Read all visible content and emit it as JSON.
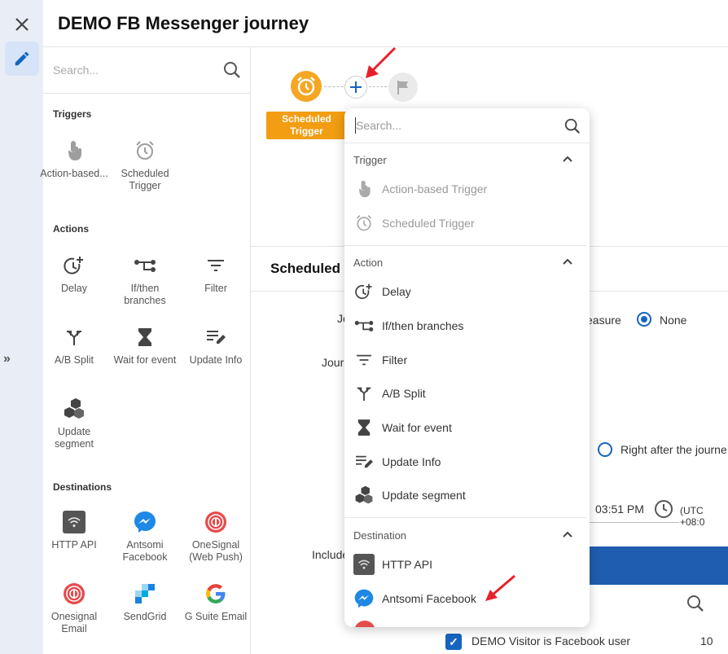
{
  "app": {
    "title": "DEMO FB Messenger journey"
  },
  "rail": {
    "close_icon": "close-icon",
    "edit_icon": "pencil-icon",
    "expand": "»"
  },
  "panel": {
    "search_placeholder": "Search...",
    "sections": {
      "triggers": "Triggers",
      "actions": "Actions",
      "destinations": "Destinations"
    },
    "triggers": [
      {
        "label": "Action-based...",
        "icon": "touch-icon"
      },
      {
        "label": "Scheduled Trigger",
        "icon": "alarm-icon"
      }
    ],
    "actions": [
      {
        "label": "Delay",
        "icon": "delay-icon"
      },
      {
        "label": "If/then branches",
        "icon": "branches-icon"
      },
      {
        "label": "Filter",
        "icon": "filter-icon"
      },
      {
        "label": "A/B Split",
        "icon": "split-icon"
      },
      {
        "label": "Wait for event",
        "icon": "hourglass-icon"
      },
      {
        "label": "Update Info",
        "icon": "edit-list-icon"
      },
      {
        "label": "Update segment",
        "icon": "hexagons-icon"
      }
    ],
    "destinations": [
      {
        "label": "HTTP API",
        "icon": "wifi-icon"
      },
      {
        "label": "Antsomi Facebook",
        "icon": "messenger-icon"
      },
      {
        "label": "OneSignal (Web Push)",
        "icon": "onesignal-icon"
      },
      {
        "label": "Onesignal Email",
        "icon": "onesignal-icon"
      },
      {
        "label": "SendGrid",
        "icon": "sendgrid-icon"
      },
      {
        "label": "G Suite Email",
        "icon": "google-icon"
      }
    ]
  },
  "canvas": {
    "node_label": "Scheduled Trigger"
  },
  "detail": {
    "title": "Scheduled",
    "frag_jo": "Jo",
    "frag_jour": "Jour",
    "frag_easure": "easure",
    "frag_none": "None",
    "frag_right_after": "Right after the journe",
    "time": "03:51 PM",
    "tz": "(UTC +08:0",
    "frag_include": "Include",
    "check_label": "DEMO Visitor is Facebook user",
    "check_count": "10"
  },
  "dropdown": {
    "search_placeholder": "Search...",
    "groups": {
      "trigger": "Trigger",
      "action": "Action",
      "destination": "Destination"
    },
    "trigger_items": [
      {
        "label": "Action-based Trigger",
        "icon": "touch-icon"
      },
      {
        "label": "Scheduled Trigger",
        "icon": "alarm-icon"
      }
    ],
    "action_items": [
      {
        "label": "Delay",
        "icon": "delay-icon"
      },
      {
        "label": "If/then branches",
        "icon": "branches-icon"
      },
      {
        "label": "Filter",
        "icon": "filter-icon"
      },
      {
        "label": "A/B Split",
        "icon": "split-icon"
      },
      {
        "label": "Wait for event",
        "icon": "hourglass-icon"
      },
      {
        "label": "Update Info",
        "icon": "edit-list-icon"
      },
      {
        "label": "Update segment",
        "icon": "hexagons-icon"
      }
    ],
    "destination_items": [
      {
        "label": "HTTP API",
        "icon": "wifi-icon"
      },
      {
        "label": "Antsomi Facebook",
        "icon": "messenger-icon"
      }
    ]
  },
  "colors": {
    "accent": "#1565c0",
    "trigger_orange": "#f29d12",
    "rail_bg": "#e9eef6",
    "messenger_blue": "#1e88e5"
  }
}
